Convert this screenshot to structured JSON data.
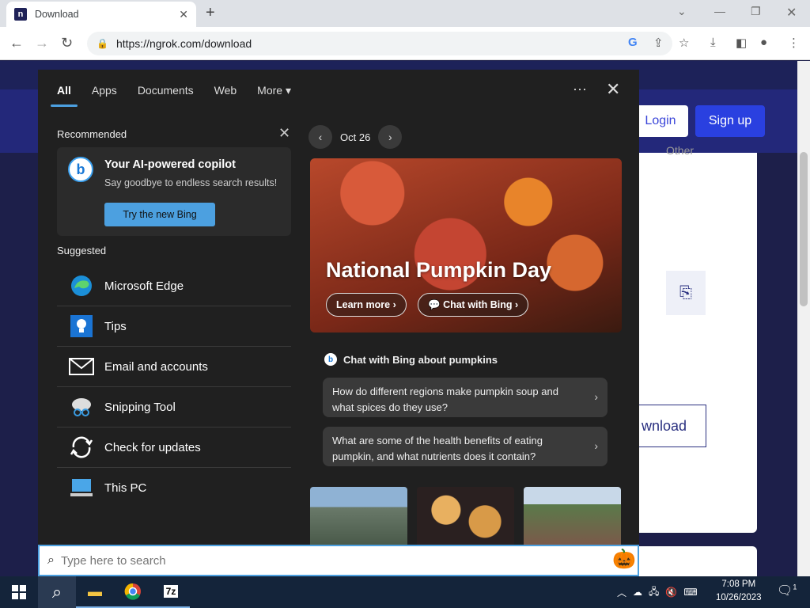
{
  "browser": {
    "tab_title": "Download",
    "favicon_letter": "n",
    "url": "https://ngrok.com/download"
  },
  "page": {
    "login": "Login",
    "signup": "Sign up",
    "other": "Other",
    "download": "wnload"
  },
  "panel": {
    "tabs": [
      "All",
      "Apps",
      "Documents",
      "Web",
      "More"
    ],
    "recommended": {
      "title": "Recommended",
      "card_title": "Your AI-powered copilot",
      "card_subtitle": "Say goodbye to endless search results!",
      "card_button": "Try the new Bing"
    },
    "suggested": {
      "title": "Suggested",
      "items": [
        {
          "label": "Microsoft Edge",
          "icon": "edge-icon"
        },
        {
          "label": "Tips",
          "icon": "tips-icon"
        },
        {
          "label": "Email and accounts",
          "icon": "mail-icon"
        },
        {
          "label": "Snipping Tool",
          "icon": "snipping-tool-icon"
        },
        {
          "label": "Check for updates",
          "icon": "update-icon"
        },
        {
          "label": "This PC",
          "icon": "computer-icon"
        }
      ]
    },
    "date": "Oct 26",
    "hero": {
      "title": "National Pumpkin Day",
      "learn_more": "Learn more",
      "chat_with_bing": "Chat with Bing"
    },
    "chat": {
      "heading": "Chat with Bing about pumpkins",
      "q1": "How do different regions make pumpkin soup and what spices do they use?",
      "q2": "What are some of the health benefits of eating pumpkin, and what nutrients does it contain?"
    }
  },
  "search": {
    "placeholder": "Type here to search"
  },
  "taskbar": {
    "time": "7:08 PM",
    "date": "10/26/2023",
    "notification_count": "1",
    "app_7z": "7z"
  }
}
